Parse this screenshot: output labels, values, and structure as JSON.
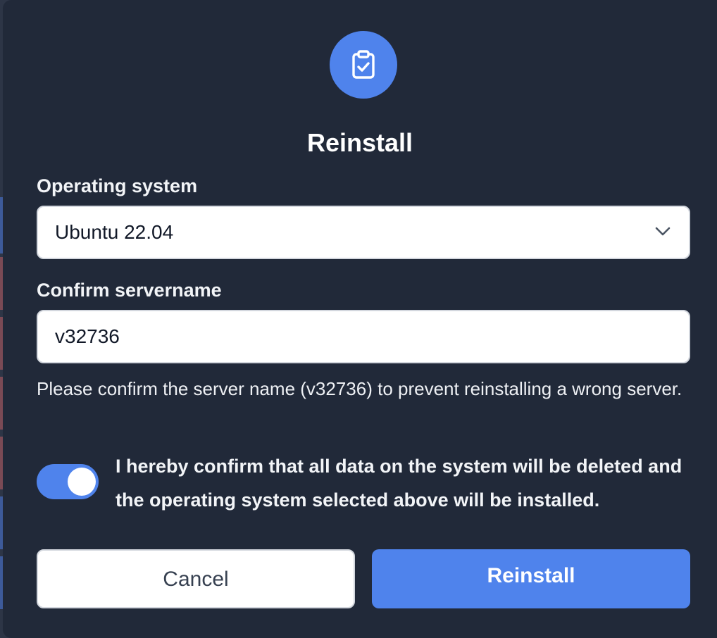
{
  "dialog": {
    "icon": "clipboard-check-icon",
    "title": "Reinstall",
    "os_label": "Operating system",
    "os_selected": "Ubuntu 22.04",
    "confirm_label": "Confirm servername",
    "confirm_value": "v32736",
    "help_text": "Please confirm the server name (v32736) to prevent reinstalling a wrong server.",
    "consent_toggle_on": true,
    "consent_text": "I hereby confirm that all data on the system will be deleted and the operating system selected above will be installed.",
    "cancel_label": "Cancel",
    "reinstall_label": "Reinstall"
  },
  "colors": {
    "modal_bg": "#212939",
    "accent": "#4f83ec",
    "input_bg": "#ffffff"
  }
}
